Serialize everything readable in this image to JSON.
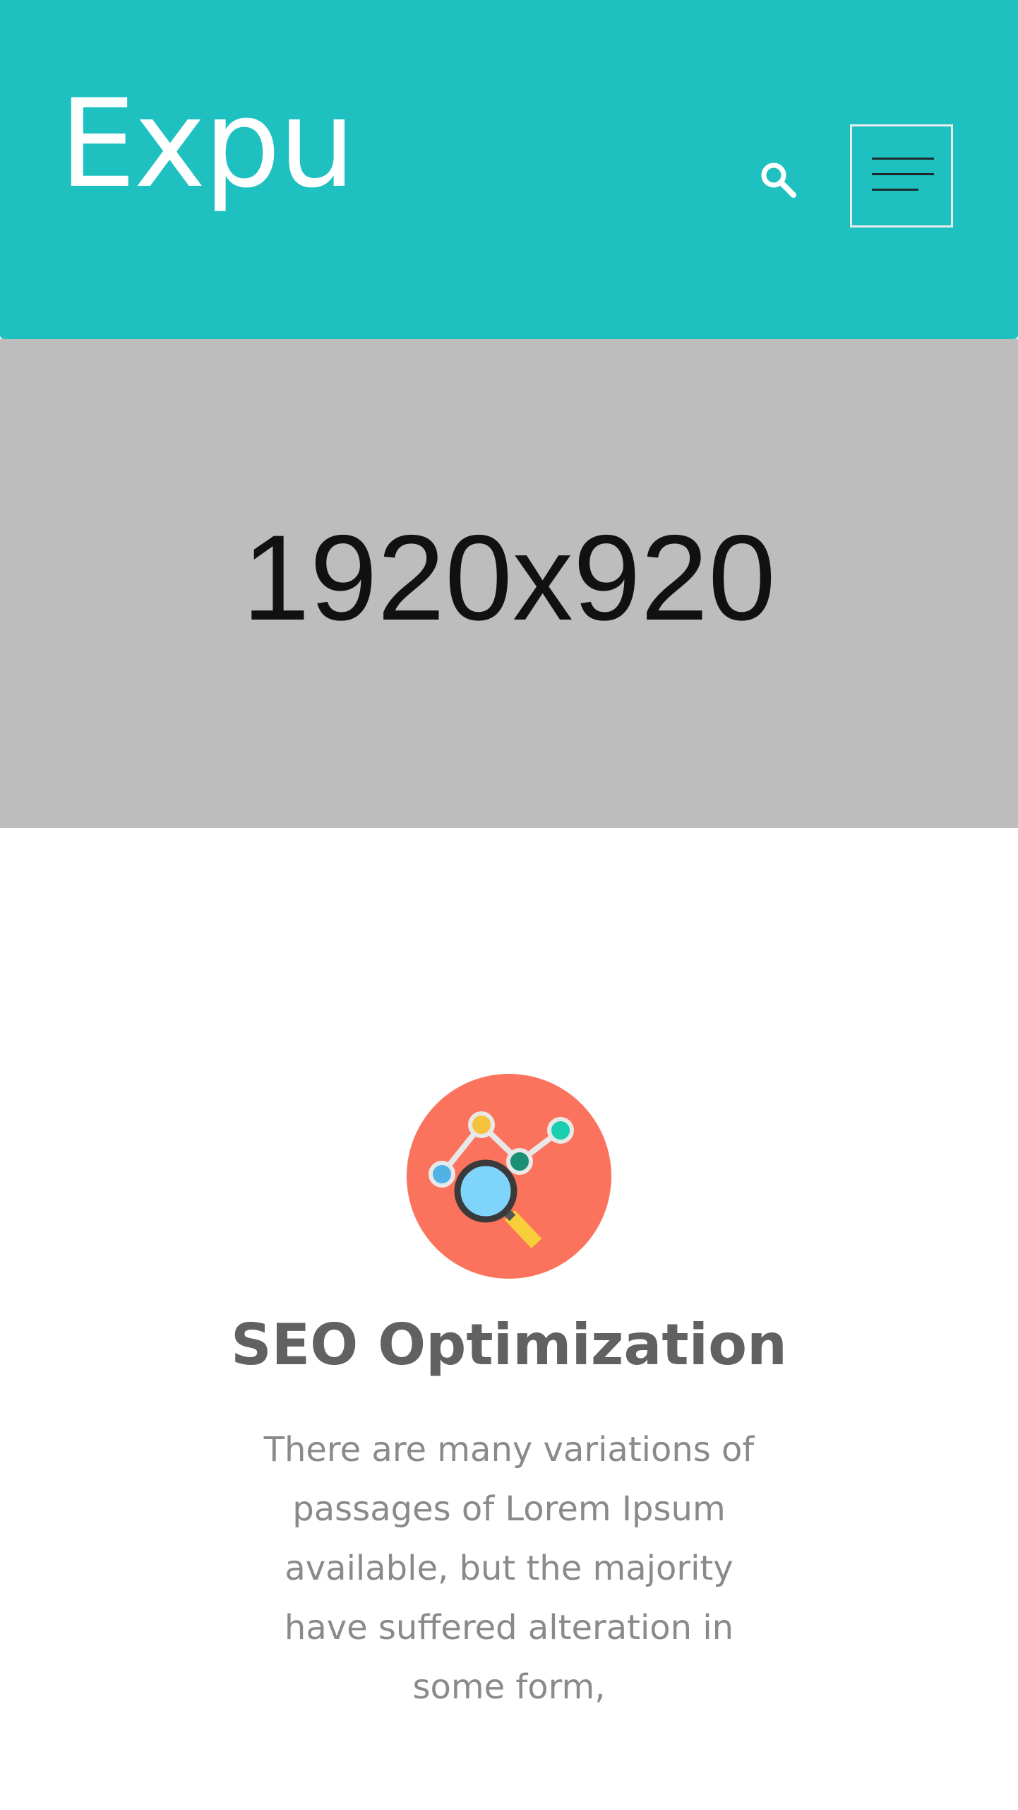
{
  "header": {
    "logo_text": "Expu",
    "search_icon": "search-icon",
    "menu_icon": "hamburger-menu-icon",
    "background_color": "#1fc0c0"
  },
  "hero": {
    "placeholder_text": "1920x920",
    "background_color": "#bdbdbd"
  },
  "feature": {
    "icon": "seo-analytics-icon",
    "title": "SEO Optimization",
    "description": "There are many variations of passages of Lorem Ipsum available, but the majority have suffered alteration in some form,"
  }
}
